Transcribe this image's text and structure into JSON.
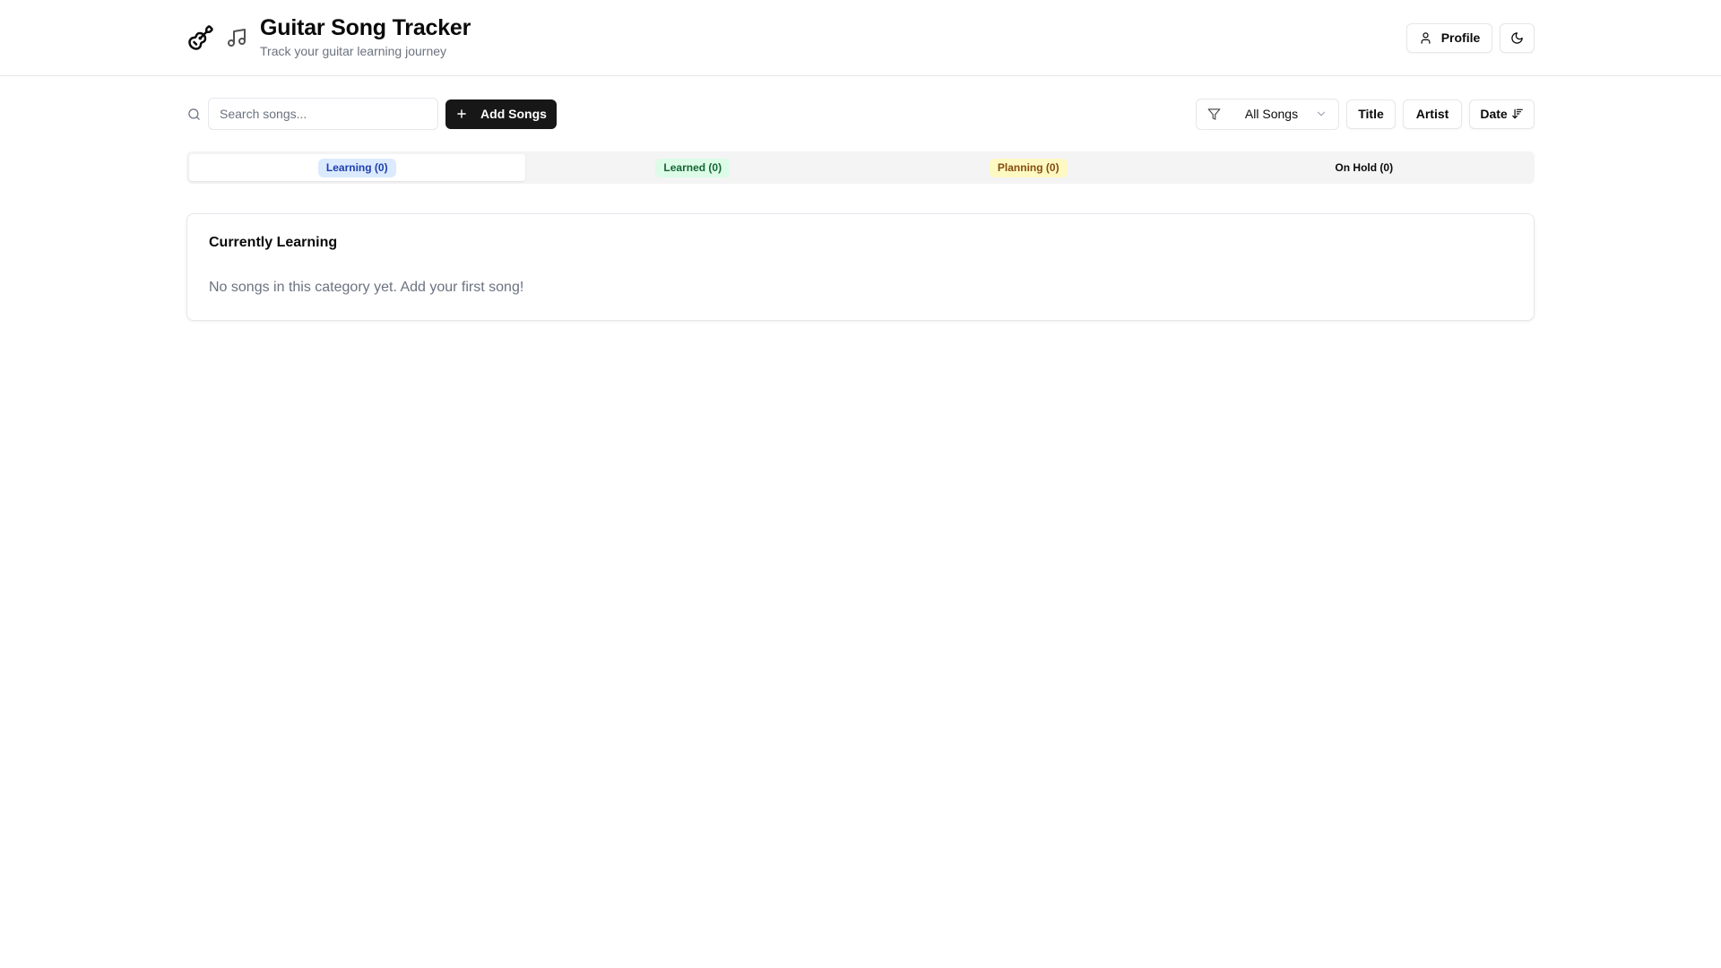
{
  "header": {
    "title": "Guitar Song Tracker",
    "subtitle": "Track your guitar learning journey",
    "icons": [
      "guitar-icon",
      "music-note-icon"
    ],
    "profile_label": "Profile",
    "theme_toggle_icon": "moon-icon"
  },
  "toolbar": {
    "search_placeholder": "Search songs...",
    "search_value": "",
    "add_label": "Add Songs",
    "filter_selected": "All Songs",
    "sort_title": "Title",
    "sort_artist": "Artist",
    "sort_date": "Date"
  },
  "tabs": [
    {
      "label": "Learning (0)",
      "active": true,
      "color": "#dbeafe"
    },
    {
      "label": "Learned (0)",
      "active": false,
      "color": "#dcfce7"
    },
    {
      "label": "Planning (0)",
      "active": false,
      "color": "#fef9c3"
    },
    {
      "label": "On Hold (0)",
      "active": false,
      "color": ""
    }
  ],
  "card": {
    "title": "Currently Learning",
    "empty_message": "No songs in this category yet. Add your first song!"
  },
  "colors": {
    "primary_button": "#171717",
    "border": "#e5e7eb",
    "muted_text": "#6b7280"
  }
}
